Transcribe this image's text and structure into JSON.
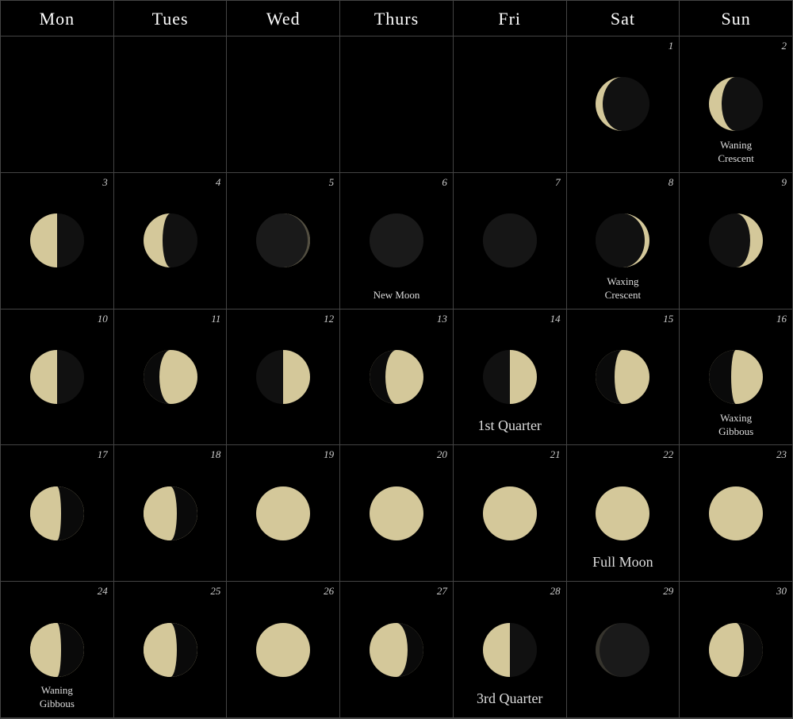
{
  "header": {
    "days": [
      "Mon",
      "Tues",
      "Wed",
      "Thurs",
      "Fri",
      "Sat",
      "Sun"
    ]
  },
  "cells": [
    {
      "day": null,
      "label": null,
      "phase": null
    },
    {
      "day": null,
      "label": null,
      "phase": null
    },
    {
      "day": null,
      "label": null,
      "phase": null
    },
    {
      "day": null,
      "label": null,
      "phase": null
    },
    {
      "day": null,
      "label": null,
      "phase": null
    },
    {
      "day": "1",
      "label": null,
      "phase": "waning-crescent-large"
    },
    {
      "day": "2",
      "label": "Waning\nCrescent",
      "phase": "waning-crescent"
    },
    {
      "day": "3",
      "label": null,
      "phase": "last-quarter-minus"
    },
    {
      "day": "4",
      "label": null,
      "phase": "waning-gibbous-slight"
    },
    {
      "day": "5",
      "label": null,
      "phase": "new-moon-slight"
    },
    {
      "day": "6",
      "label": "New Moon",
      "phase": "new-moon",
      "bigLabel": false
    },
    {
      "day": "7",
      "label": null,
      "phase": "new-moon-dark"
    },
    {
      "day": "8",
      "label": "Waxing\nCrescent",
      "phase": "waxing-crescent-thin"
    },
    {
      "day": "9",
      "label": null,
      "phase": "waxing-crescent"
    },
    {
      "day": "10",
      "label": null,
      "phase": "last-quarter"
    },
    {
      "day": "11",
      "label": null,
      "phase": "waxing-gibbous-small"
    },
    {
      "day": "12",
      "label": null,
      "phase": "waxing-quarter"
    },
    {
      "day": "13",
      "label": null,
      "phase": "waxing-gibbous"
    },
    {
      "day": "14",
      "label": "1st Quarter",
      "phase": "first-quarter",
      "bigLabel": true
    },
    {
      "day": "15",
      "label": null,
      "phase": "waxing-gibbous-more"
    },
    {
      "day": "16",
      "label": "Waxing\nGibbous",
      "phase": "waxing-gibbous-full"
    },
    {
      "day": "17",
      "label": null,
      "phase": "full-moon-slight"
    },
    {
      "day": "18",
      "label": null,
      "phase": "full-moon-slight2"
    },
    {
      "day": "19",
      "label": null,
      "phase": "full-moon"
    },
    {
      "day": "20",
      "label": null,
      "phase": "full-moon"
    },
    {
      "day": "21",
      "label": null,
      "phase": "full-moon"
    },
    {
      "day": "22",
      "label": "Full Moon",
      "phase": "full-moon",
      "bigLabel": true
    },
    {
      "day": "23",
      "label": null,
      "phase": "full-moon"
    },
    {
      "day": "24",
      "label": "Waning\nGibbous",
      "phase": "full-moon-slight"
    },
    {
      "day": "25",
      "label": null,
      "phase": "full-moon-slight2"
    },
    {
      "day": "26",
      "label": null,
      "phase": "full-moon"
    },
    {
      "day": "27",
      "label": null,
      "phase": "waning-gibbous-crescent"
    },
    {
      "day": "28",
      "label": "3rd Quarter",
      "phase": "third-quarter",
      "bigLabel": true
    },
    {
      "day": "29",
      "label": null,
      "phase": "waning-dark"
    },
    {
      "day": "30",
      "label": null,
      "phase": "waning-crescent-right"
    },
    {
      "day": null,
      "label": null,
      "phase": null
    },
    {
      "day": null,
      "label": null,
      "phase": null
    },
    {
      "day": null,
      "label": null,
      "phase": null
    },
    {
      "day": null,
      "label": null,
      "phase": null
    },
    {
      "day": null,
      "label": null,
      "phase": null
    },
    {
      "day": null,
      "label": null,
      "phase": null
    },
    {
      "day": null,
      "label": null,
      "phase": null
    }
  ]
}
